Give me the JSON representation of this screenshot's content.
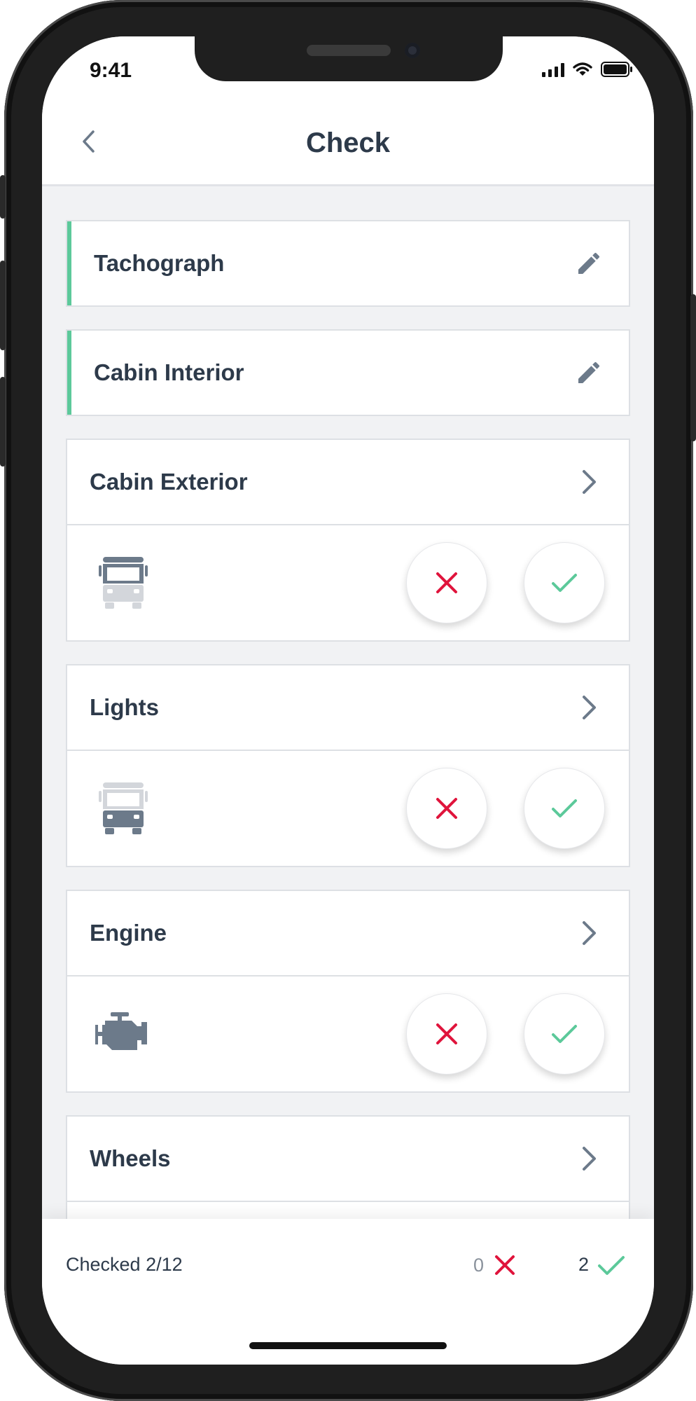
{
  "status_bar": {
    "time": "9:41"
  },
  "header": {
    "title": "Check"
  },
  "sections": [
    {
      "title": "Tachograph",
      "state": "completed",
      "action_icon": "pencil-icon"
    },
    {
      "title": "Cabin Interior",
      "state": "completed",
      "action_icon": "pencil-icon"
    },
    {
      "title": "Cabin Exterior",
      "state": "pending",
      "action_icon": "chevron-right-icon",
      "illustration": "bus-top-highlight-icon"
    },
    {
      "title": "Lights",
      "state": "pending",
      "action_icon": "chevron-right-icon",
      "illustration": "bus-bottom-highlight-icon"
    },
    {
      "title": "Engine",
      "state": "pending",
      "action_icon": "chevron-right-icon",
      "illustration": "engine-icon"
    },
    {
      "title": "Wheels",
      "state": "pending",
      "action_icon": "chevron-right-icon"
    }
  ],
  "footer": {
    "checked_label": "Checked 2/12",
    "rejected_count": "0",
    "passed_count": "2"
  },
  "colors": {
    "accent_green": "#5cc99a",
    "reject_red": "#e0143c",
    "text_dark": "#2d3a4a",
    "icon_gray": "#6c7a8a"
  }
}
